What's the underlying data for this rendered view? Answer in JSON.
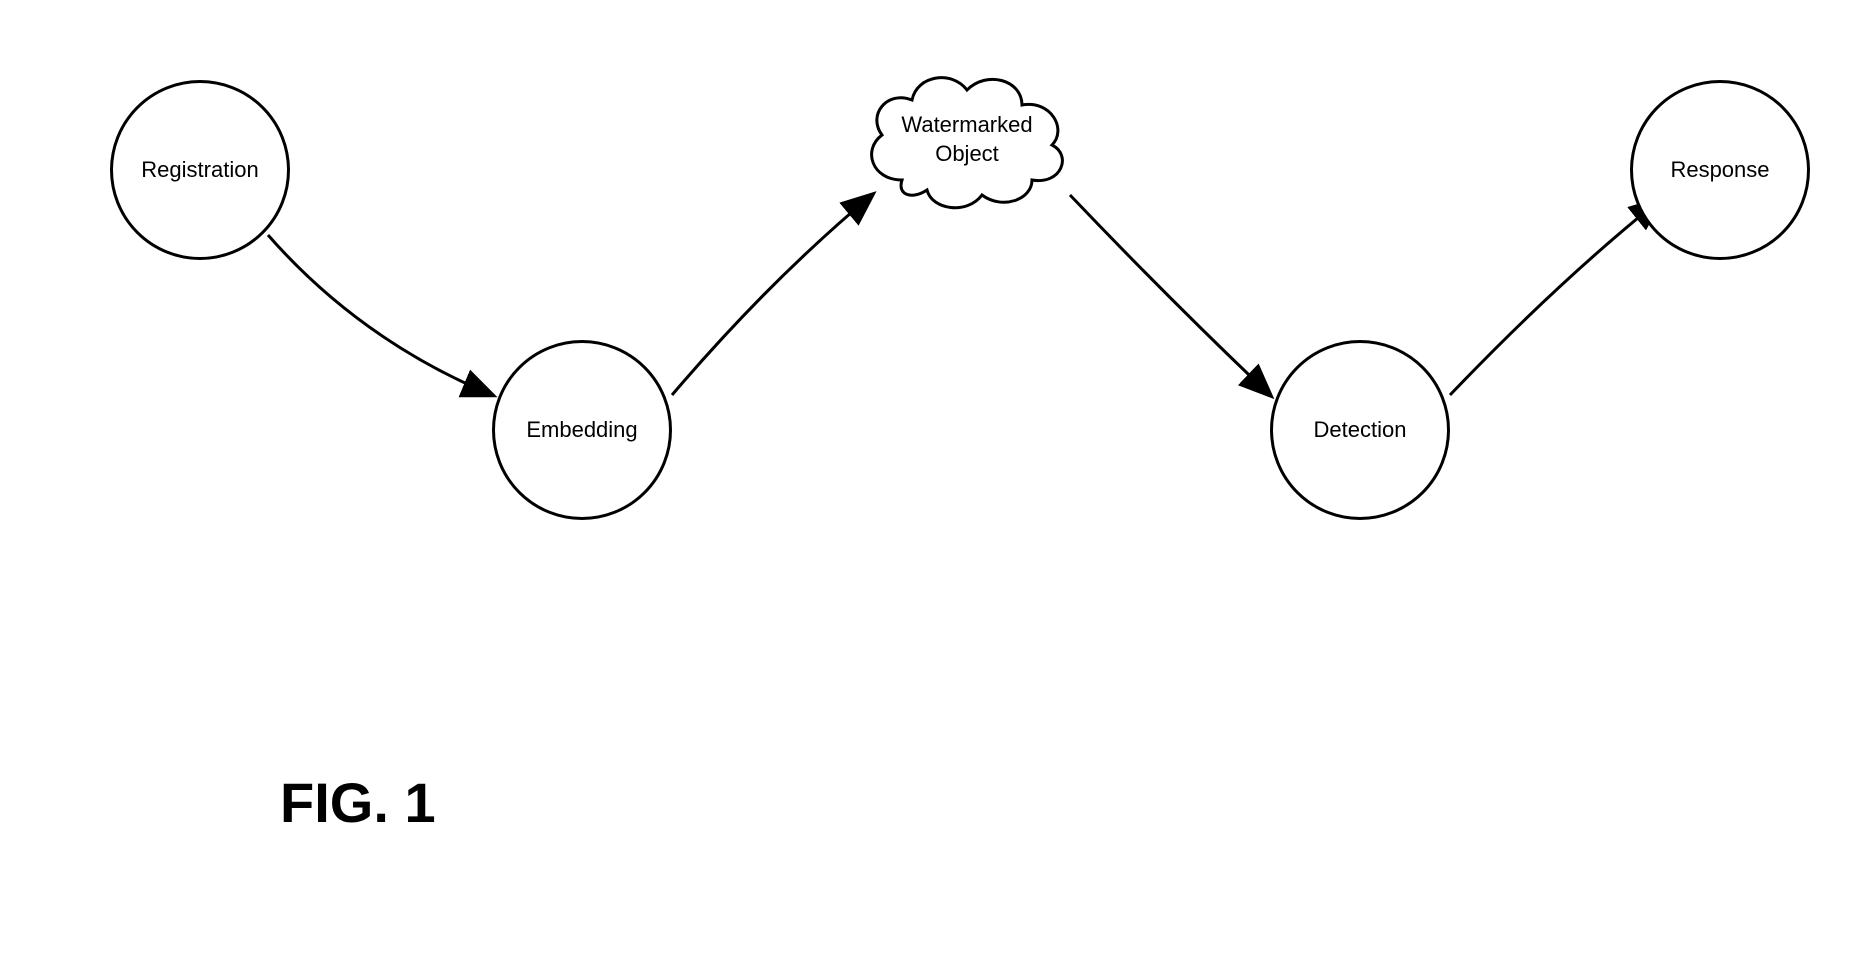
{
  "nodes": {
    "registration": "Registration",
    "embedding": "Embedding",
    "watermarked": "Watermarked\nObject",
    "detection": "Detection",
    "response": "Response"
  },
  "figure_label": "FIG. 1",
  "diagram": {
    "type": "flow-diagram",
    "sequence": [
      "Registration",
      "Embedding",
      "Watermarked Object",
      "Detection",
      "Response"
    ],
    "edges": [
      {
        "from": "Registration",
        "to": "Embedding"
      },
      {
        "from": "Embedding",
        "to": "Watermarked Object"
      },
      {
        "from": "Watermarked Object",
        "to": "Detection"
      },
      {
        "from": "Detection",
        "to": "Response"
      }
    ]
  }
}
